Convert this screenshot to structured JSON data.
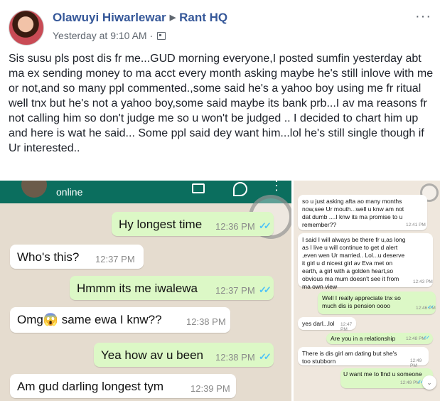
{
  "post": {
    "author": "Olawuyi Hiwarlewar",
    "group": "Rant HQ",
    "timestamp": "Yesterday at 9:10 AM",
    "separator": "·",
    "more_glyph": "···",
    "privacy_icon": "members-group-icon",
    "text": "Sis susu pls post dis fr me...GUD morning everyone,I posted sumfin yesterday abt ma ex sending money to ma acct every month asking maybe he's still inlove with me or not,and so many ppl commented.,some said he's a yahoo boy using me fr ritual well tnx but he's not a yahoo boy,some said maybe its bank prb...I av ma reasons fr not calling him so don't judge me so u won't be judged .. I decided to chart him up and here is wat he said... Some ppl said dey want him...lol he's still single though if Ur interested.."
  },
  "chat_left": {
    "status": "online",
    "menu_glyph": "⋮",
    "messages": [
      {
        "dir": "out",
        "text": "Hy longest time",
        "time": "12:36 PM",
        "ticks": "✓✓"
      },
      {
        "dir": "in",
        "text": "Who's this?",
        "time": "12:37 PM"
      },
      {
        "dir": "out",
        "text": "Hmmm its me iwalewa",
        "time": "12:37 PM",
        "ticks": "✓✓"
      },
      {
        "dir": "in",
        "text": "Omg😱 same ewa I knw??",
        "time": "12:38 PM"
      },
      {
        "dir": "out",
        "text": "Yea how av u been",
        "time": "12:38 PM",
        "ticks": "✓✓"
      },
      {
        "dir": "in",
        "text": "Am gud darling longest tym",
        "time": "12:39 PM"
      }
    ]
  },
  "chat_right": {
    "messages": [
      {
        "dir": "in",
        "text": "so u just asking afta ao many months now,see Ur mouth...well u knw am not dat dumb ....I knw its ma promise to u remember??",
        "time": "12:41 PM"
      },
      {
        "dir": "in",
        "text": "I said I will always be there fr u,as long as I live u will continue to get d alert ,even wen Ur married.. Lol...u deserve it girl u d nicest girl av Eva met on earth, a girl with a golden heart,so obvious ma mum doesn't see it from ma own view",
        "time": "12:43 PM"
      },
      {
        "dir": "out",
        "text": "Well I really appreciate tnx so much dis is pension oooo",
        "time": "12:46 PM",
        "ticks": "✓✓"
      },
      {
        "dir": "in",
        "text": "yes darl...lol",
        "time": "12:47 PM"
      },
      {
        "dir": "out",
        "text": "Are you in a relationship",
        "time": "12:48 PM",
        "ticks": "✓✓"
      },
      {
        "dir": "in",
        "text": "There is dis girl am dating but she's too stubborn",
        "time": "12:49 PM"
      },
      {
        "dir": "out",
        "text": "U want me to find u someone",
        "time": "12:49 PM",
        "ticks": "✓✓"
      }
    ],
    "scroll_glyph": "⌄"
  }
}
